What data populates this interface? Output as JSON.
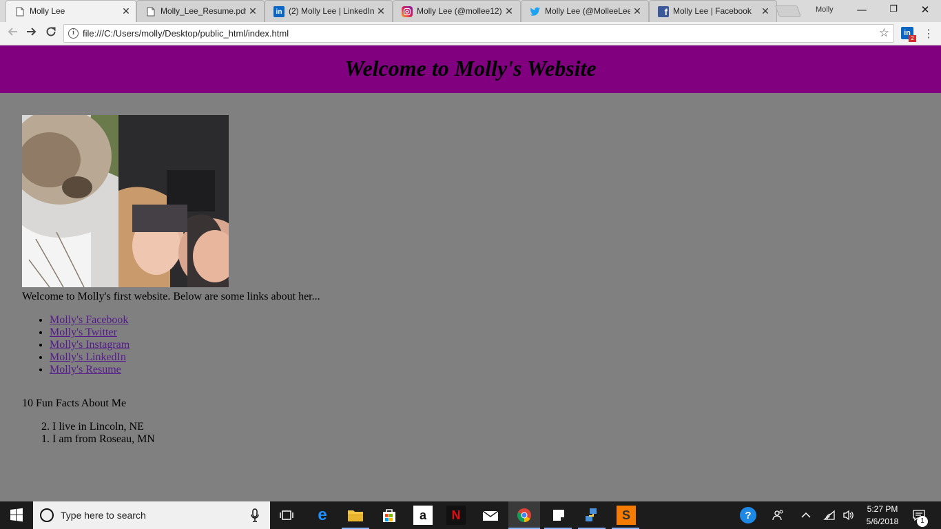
{
  "browser": {
    "tabs": [
      {
        "title": "Molly Lee",
        "icon": "page-icon",
        "active": true
      },
      {
        "title": "Molly_Lee_Resume.pdf",
        "icon": "page-icon",
        "active": false
      },
      {
        "title": "(2) Molly Lee | LinkedIn",
        "icon": "linkedin-icon",
        "active": false
      },
      {
        "title": "Molly Lee (@mollee12)",
        "icon": "instagram-icon",
        "active": false
      },
      {
        "title": "Molly Lee (@MolleeLee",
        "icon": "twitter-icon",
        "active": false
      },
      {
        "title": "Molly Lee | Facebook",
        "icon": "facebook-icon",
        "active": false
      }
    ],
    "profile_name": "Molly",
    "url": "file:///C:/Users/molly/Desktop/public_html/index.html",
    "extension_badge": "2"
  },
  "page": {
    "banner_title": "Welcome to Molly's Website",
    "banner_color": "#800080",
    "background_color": "#808080",
    "intro": "Welcome to Molly's first website. Below are some links about her...",
    "links": [
      "Molly's Facebook",
      "Molly's Twitter",
      "Molly's Instagram",
      "Molly's LinkedIn",
      "Molly's Resume"
    ],
    "facts_title": "10 Fun Facts About Me",
    "facts": [
      {
        "num": "2.",
        "text": "I live in Lincoln, NE"
      },
      {
        "num": "1.",
        "text": "I am from Roseau, MN"
      }
    ]
  },
  "taskbar": {
    "search_placeholder": "Type here to search",
    "time": "5:27 PM",
    "date": "5/6/2018",
    "notification_count": "1"
  }
}
